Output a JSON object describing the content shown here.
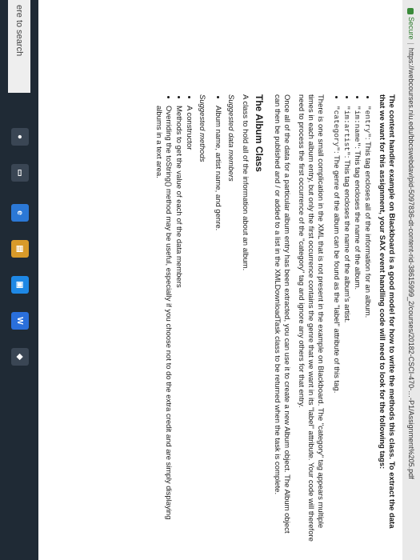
{
  "browser": {
    "secure_label": "Secure",
    "url": "https://webcourses.niu.edu/bbcswebdav/pid-5097836-dt-content-rid-38615999_2/courses/20182-CSCI-470-…-P1/Assignment%205.pdf"
  },
  "document": {
    "intro": "The content handler example on Blackboard is a good model for how to write the methods this class. To extract the data that we want for this assignment, your SAX event handling code will need to look for the following tags:",
    "tags": [
      {
        "code": "\"entry\"",
        "text": ": This tag encloses all of the information for an album."
      },
      {
        "code": "\"im:name\"",
        "text": ": This tag encloses the name of the album."
      },
      {
        "code": "\"im:artist\"",
        "text": ": This tag encloses the name of the album's artist."
      },
      {
        "code": "\"category\"",
        "text": ": The genre of the album can be found as the \"label\" attribute of this tag."
      }
    ],
    "complication": "There is one small complication in the XML that is not present in the example on Blackboard. The \"category\" tag appears multiple times in each album entry, but only the first occurrence contains the genre that we want in its \"label\" attribute. Your code will therefore need to process the first occurrence of the \"category\" tag and ignore any others for that entry.",
    "once": "Once all of the data for a particular album entry has been extracted, you can use it to create a new Album object. The Album object can then be published and / or added to a list in the XMLDownloadTask class to be returned when the task is complete.",
    "album_class_heading": "The Album Class",
    "album_class_desc": "A class to hold all of the information about an album.",
    "suggested_members_label": "Suggested data members",
    "members": [
      "Album name, artist name, and genre."
    ],
    "suggested_methods_label": "Suggested methods",
    "methods": [
      "A constructor",
      "Methods to get the value of each of the data members",
      "Overriding the toString() method may be useful, especially if you choose not to do the extra credit and are simply displaying albums in a text area."
    ]
  },
  "taskbar": {
    "search_text": "ere to search"
  }
}
